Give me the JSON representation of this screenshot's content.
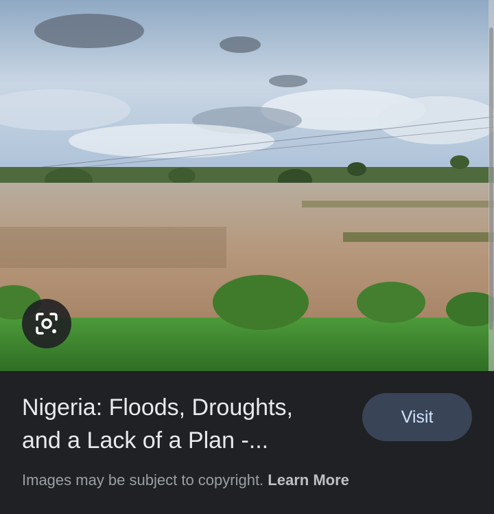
{
  "image": {
    "subject": "flooded-farmland-photo",
    "colors": {
      "sky": "#9fb7cf",
      "water": "#a88e74",
      "grass": "#3f8a2f"
    }
  },
  "lens": {
    "icon": "google-lens-icon"
  },
  "result": {
    "title": "Nigeria: Floods, Droughts, and a Lack of a Plan -...",
    "visit_label": "Visit"
  },
  "copyright": {
    "text": "Images may be subject to copyright.",
    "link": "Learn More"
  },
  "colors": {
    "panel_bg": "#202124",
    "button_bg": "#394457",
    "button_text": "#d2e3fc"
  }
}
